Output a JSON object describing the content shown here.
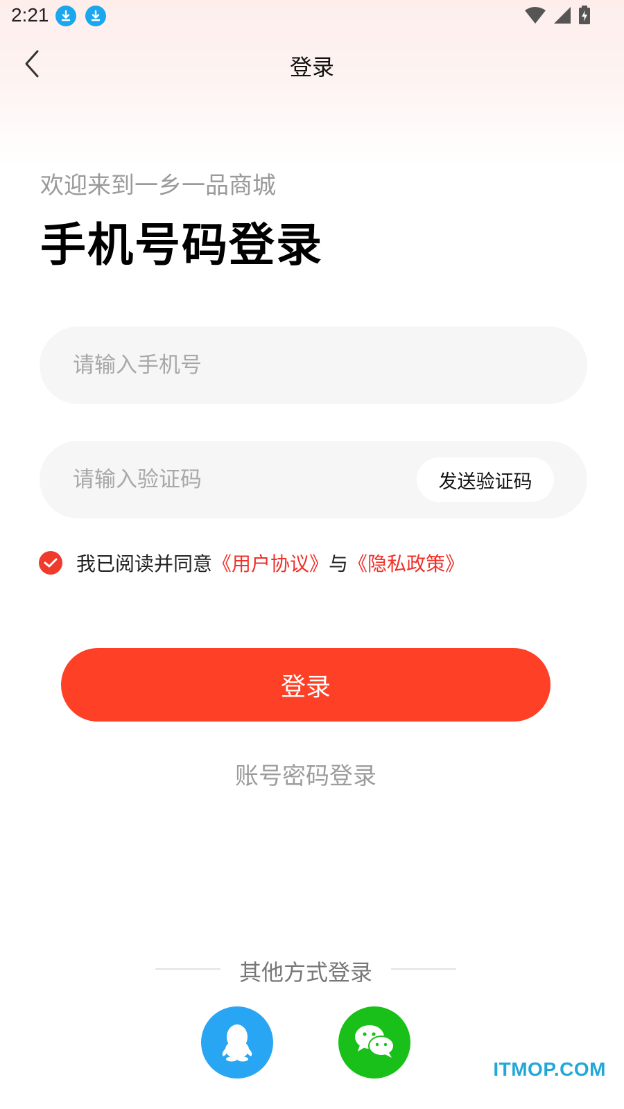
{
  "status_bar": {
    "time": "2:21"
  },
  "nav": {
    "title": "登录"
  },
  "header": {
    "welcome": "欢迎来到一乡一品商城",
    "title": "手机号码登录"
  },
  "form": {
    "phone_placeholder": "请输入手机号",
    "code_placeholder": "请输入验证码",
    "send_code_label": "发送验证码"
  },
  "agreement": {
    "checked": true,
    "prefix": "我已阅读并同意",
    "user_agreement": "《用户协议》",
    "and": "与",
    "privacy_policy": "《隐私政策》"
  },
  "actions": {
    "login_label": "登录",
    "account_login_label": "账号密码登录"
  },
  "other_login": {
    "label": "其他方式登录",
    "methods": [
      "qq",
      "wechat"
    ]
  },
  "watermark": "ITMOP.COM",
  "colors": {
    "accent": "#fe4126",
    "link": "#f0302a",
    "qq": "#28a5f3",
    "wechat": "#19c019",
    "download_badge": "#1ba7ee"
  },
  "icons": [
    "download-icon",
    "wifi-icon",
    "signal-icon",
    "battery-icon",
    "back-arrow-icon",
    "check-icon",
    "qq-icon",
    "wechat-icon"
  ]
}
